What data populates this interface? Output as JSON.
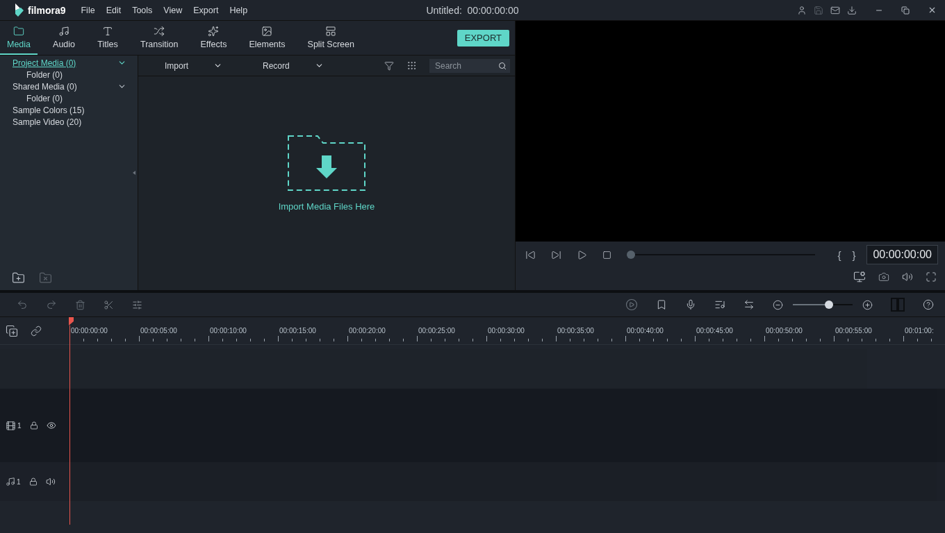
{
  "app": {
    "logo": "filmora9",
    "menu": [
      "File",
      "Edit",
      "Tools",
      "View",
      "Export",
      "Help"
    ],
    "title": "Untitled:  00:00:00:00"
  },
  "tabs": [
    {
      "label": "Media",
      "kind": "media",
      "selected": true
    },
    {
      "label": "Audio",
      "kind": "audio",
      "selected": false
    },
    {
      "label": "Titles",
      "kind": "titles",
      "selected": false
    },
    {
      "label": "Transition",
      "kind": "transition",
      "selected": false
    },
    {
      "label": "Effects",
      "kind": "effects",
      "selected": false
    },
    {
      "label": "Elements",
      "kind": "elements",
      "selected": false
    },
    {
      "label": "Split Screen",
      "kind": "split",
      "selected": false
    }
  ],
  "export_button": "EXPORT",
  "sidebar": {
    "items": [
      {
        "label": "Project Media (0)",
        "selected": true,
        "expanded": true,
        "children": [
          {
            "label": "Folder (0)",
            "selected": false
          }
        ]
      },
      {
        "label": "Shared Media (0)",
        "selected": false,
        "expanded": true,
        "children": [
          {
            "label": "Folder (0)",
            "selected": false
          }
        ]
      },
      {
        "label": "Sample Colors (15)",
        "selected": false
      },
      {
        "label": "Sample Video (20)",
        "selected": false
      }
    ]
  },
  "media_toolbar": {
    "import": "Import",
    "record": "Record",
    "search": {
      "placeholder": "Search"
    }
  },
  "drop_zone": {
    "label": "Import Media Files Here"
  },
  "player": {
    "progress": {
      "level": 0
    },
    "mark_in": "{",
    "mark_out": "}",
    "time": "00:00:00:00"
  },
  "timeline": {
    "zoom": {
      "level": 0.6
    },
    "ruler": [
      "00:00:00:00",
      "00:00:05:00",
      "00:00:10:00",
      "00:00:15:00",
      "00:00:20:00",
      "00:00:25:00",
      "00:00:30:00",
      "00:00:35:00",
      "00:00:40:00",
      "00:00:45:00",
      "00:00:50:00",
      "00:00:55:00",
      "00:01:00:"
    ],
    "tracks": [
      {
        "kind": "video",
        "number": "1"
      },
      {
        "kind": "audio",
        "number": "1"
      }
    ]
  }
}
